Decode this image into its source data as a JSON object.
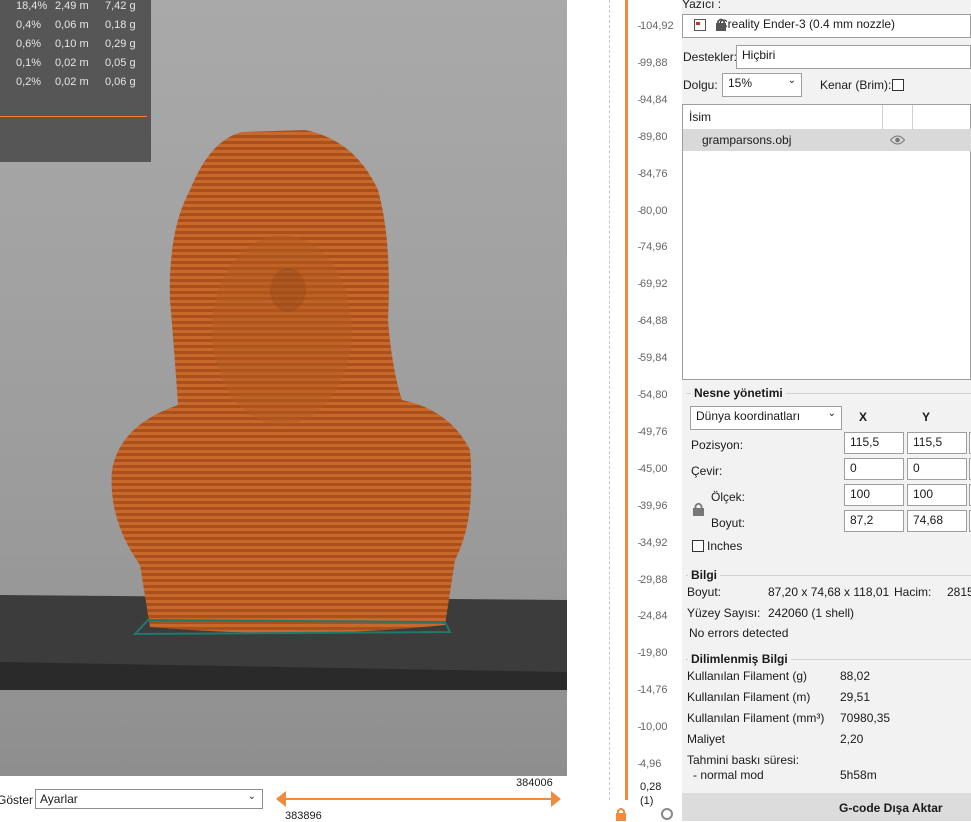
{
  "stats": {
    "rows": [
      [
        "18,4%",
        "2,49 m",
        "7,42 g"
      ],
      [
        "0,4%",
        "0,06 m",
        "0,18 g"
      ],
      [
        "0,6%",
        "0,10 m",
        "0,29 g"
      ],
      [
        "0,1%",
        "0,02 m",
        "0,05 g"
      ],
      [
        "0,2%",
        "0,02 m",
        "0,06 g"
      ]
    ]
  },
  "bottom": {
    "show_label": "Göster",
    "show_value": "Ayarlar",
    "hslider_max": "384006",
    "hslider_min": "383896"
  },
  "layer_slider": {
    "ticks": [
      "104,92",
      "99,88",
      "94,84",
      "89,80",
      "84,76",
      "80,00",
      "74,96",
      "69,92",
      "64,88",
      "59,84",
      "54,80",
      "49,76",
      "45,00",
      "39,96",
      "34,92",
      "29,88",
      "24,84",
      "19,80",
      "14,76",
      "10,00",
      "4,96"
    ],
    "min_value": "0,28",
    "min_index": "(1)"
  },
  "panel": {
    "printer_label": "Yazıcı :",
    "printer_value": "Creality Ender-3 (0.4 mm nozzle)",
    "supports_label": "Destekler:",
    "supports_value": "Hiçbiri",
    "infill_label": "Dolgu:",
    "infill_value": "15%",
    "brim_label": "Kenar (Brim):",
    "list_header": "İsim",
    "object_name": "gramparsons.obj",
    "obj_mgmt_title": "Nesne yönetimi",
    "coord_system": "Dünya koordinatları",
    "col_x": "X",
    "col_y": "Y",
    "position_label": "Pozisyon:",
    "rotate_label": "Çevir:",
    "scale_label": "Ölçek:",
    "size_label": "Boyut:",
    "position": [
      "115,5",
      "115,5"
    ],
    "rotate": [
      "0",
      "0"
    ],
    "scale": [
      "100",
      "100"
    ],
    "size": [
      "87,2",
      "74,68"
    ],
    "inches_label": "Inches",
    "info_title": "Bilgi",
    "info_size_label": "Boyut:",
    "info_size_value": "87,20 x 74,68 x 118,01",
    "volume_label": "Hacim:",
    "volume_value": "2815",
    "facets_label": "Yüzey Sayısı:",
    "facets_value": "242060 (1 shell)",
    "errors": "No errors detected",
    "sliced_title": "Dilimlenmiş Bilgi",
    "filament_g_label": "Kullanılan Filament (g)",
    "filament_g_value": "88,02",
    "filament_m_label": "Kullanılan Filament (m)",
    "filament_m_value": "29,51",
    "filament_mm3_label": "Kullanılan Filament (mm³)",
    "filament_mm3_value": "70980,35",
    "cost_label": "Maliyet",
    "cost_value": "2,20",
    "print_time_label": "Tahmini baskı süresi:",
    "normal_mode_label": "- normal mod",
    "normal_mode_value": "5h58m",
    "export_label": "G-code Dışa Aktar"
  },
  "colors": {
    "accent": "#f08a3c",
    "model": "#c8642a",
    "panel_bg": "#f2f2f2",
    "stats_bg": "#565656"
  }
}
